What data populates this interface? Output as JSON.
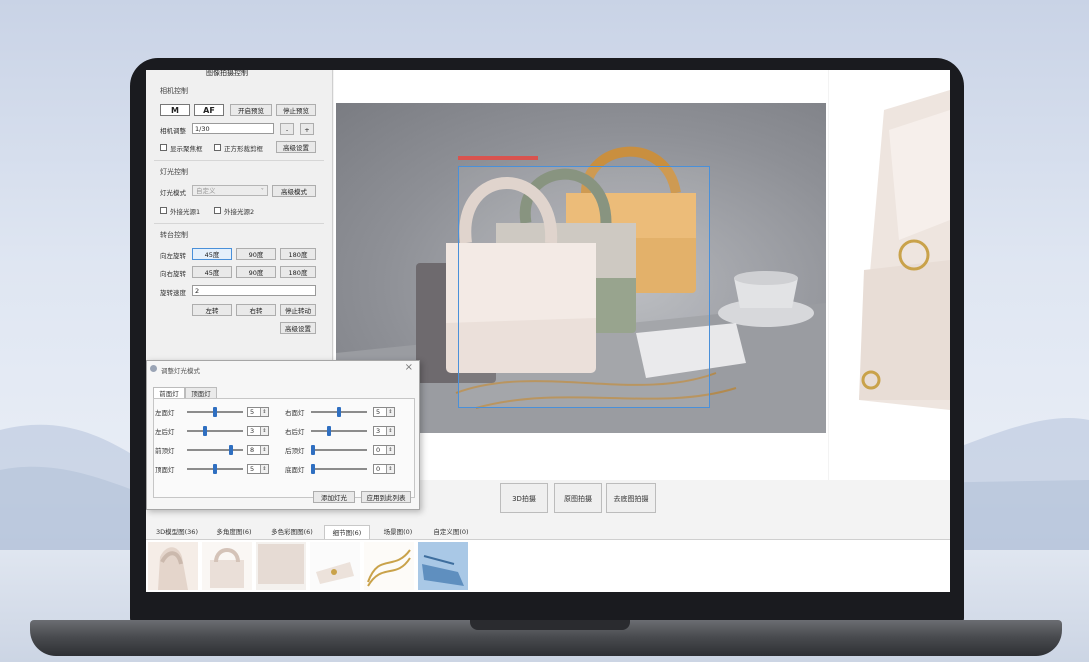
{
  "panel": {
    "title": "图像拍摄控制",
    "camera_section": "相机控制",
    "btn_m": "M",
    "btn_af": "AF",
    "btn_start_preview": "开启预览",
    "btn_stop_preview": "停止预览",
    "shutter_label": "相机调整",
    "shutter_value": "1/30",
    "minus": "-",
    "plus": "+",
    "cb_show_focus": "显示聚焦框",
    "cb_cross": "正方形裁剪框",
    "btn_advanced_settings": "高级设置",
    "light_section": "灯光控制",
    "light_mode_label": "灯光模式",
    "light_mode_value": "自定义",
    "btn_advanced_mode": "高级模式",
    "cb_ext_light1": "外接光源1",
    "cb_ext_light2": "外接光源2",
    "turntable_section": "转台控制",
    "left_rotate_label": "向左旋转",
    "right_rotate_label": "向右旋转",
    "r_45": "45度",
    "r_90": "90度",
    "r_180": "180度",
    "speed_label": "旋转速度",
    "speed_value": "2",
    "btn_left": "左转",
    "btn_right": "右转",
    "btn_stop_rotate": "停止转动",
    "btn_advanced_settings2": "高级设置"
  },
  "dialog": {
    "title": "调整灯光模式",
    "close": "×",
    "tab1": "前面灯",
    "tab2": "顶面灯",
    "rows": [
      {
        "l_label": "左面灯",
        "l_val": "5",
        "r_label": "右面灯",
        "r_val": "5",
        "l_level": 0.5,
        "r_level": 0.5
      },
      {
        "l_label": "左后灯",
        "l_val": "3",
        "r_label": "右后灯",
        "r_val": "3",
        "l_level": 0.3,
        "r_level": 0.3
      },
      {
        "l_label": "前顶灯",
        "l_val": "8",
        "r_label": "后顶灯",
        "r_val": "0",
        "l_level": 0.8,
        "r_level": 0.0
      },
      {
        "l_label": "顶面灯",
        "l_val": "5",
        "r_label": "底面灯",
        "r_val": "0",
        "l_level": 0.5,
        "r_level": 0.0
      }
    ],
    "btn_add_light": "添加灯光",
    "btn_apply": "应用到此列表"
  },
  "bottom_buttons": [
    "3D拍摄",
    "原图拍摄",
    "去底图拍摄"
  ],
  "tabs": [
    {
      "label": "3D模型图(36)",
      "active": false
    },
    {
      "label": "多角度图(6)",
      "active": false
    },
    {
      "label": "多色彩图图(6)",
      "active": false
    },
    {
      "label": "细节图(6)",
      "active": true
    },
    {
      "label": "场景图(0)",
      "active": false
    },
    {
      "label": "自定义图(0)",
      "active": false
    }
  ],
  "colors": {
    "accent": "#4a90d9",
    "selected_thumb": "#a9c8e6",
    "bag_pink": "#e9ddd6",
    "bag_green": "#8d9a82",
    "bag_yellow": "#e0a95a"
  }
}
